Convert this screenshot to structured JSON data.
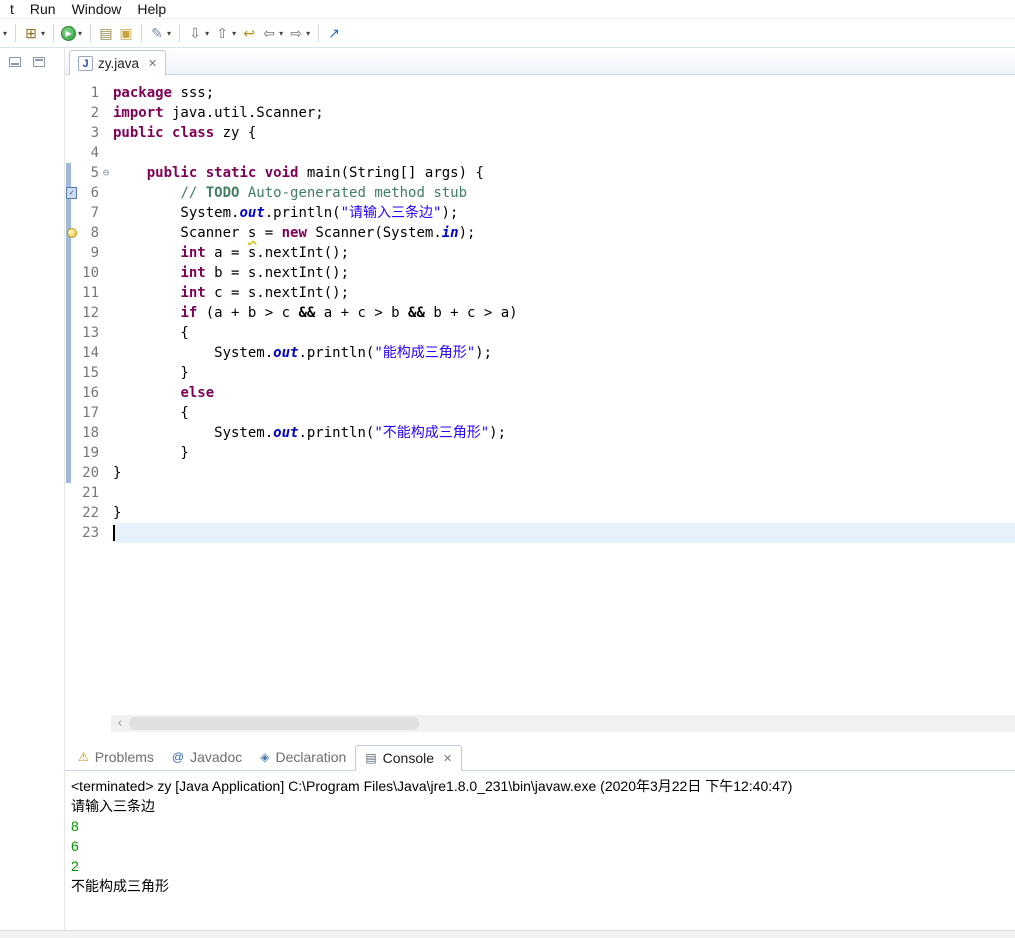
{
  "menu": {
    "items": [
      "t",
      "Run",
      "Window",
      "Help"
    ]
  },
  "toolbar": {
    "items": [
      {
        "type": "caret",
        "name": "toolbar-overflow-caret"
      },
      {
        "type": "sep"
      },
      {
        "type": "icon",
        "name": "new-wizard-icon",
        "glyph": "⊞",
        "color": "#8a6d1c"
      },
      {
        "type": "caret",
        "name": "new-wizard-caret"
      },
      {
        "type": "sep"
      },
      {
        "type": "run",
        "name": "run-icon",
        "glyph": "▶"
      },
      {
        "type": "caret",
        "name": "run-caret"
      },
      {
        "type": "sep"
      },
      {
        "type": "icon",
        "name": "print-icon",
        "glyph": "▤",
        "color": "#9a8a4a"
      },
      {
        "type": "icon",
        "name": "open-folder-icon",
        "glyph": "▣",
        "color": "#c8a43c"
      },
      {
        "type": "sep"
      },
      {
        "type": "icon",
        "name": "format-annotation-icon",
        "glyph": "✎",
        "color": "#7a8aa0"
      },
      {
        "type": "caret",
        "name": "format-annotation-caret"
      },
      {
        "type": "sep"
      },
      {
        "type": "icon",
        "name": "next-annotation-icon",
        "glyph": "⇩",
        "color": "#707070"
      },
      {
        "type": "caret",
        "name": "next-annotation-caret"
      },
      {
        "type": "icon",
        "name": "previous-annotation-icon",
        "glyph": "⇧",
        "color": "#707070"
      },
      {
        "type": "caret",
        "name": "previous-annotation-caret"
      },
      {
        "type": "icon",
        "name": "last-edit-location-icon",
        "glyph": "↩",
        "color": "#b89018"
      },
      {
        "type": "icon",
        "name": "back-icon",
        "glyph": "⇦",
        "color": "#707070"
      },
      {
        "type": "caret",
        "name": "back-caret"
      },
      {
        "type": "icon",
        "name": "forward-icon",
        "glyph": "⇨",
        "color": "#707070"
      },
      {
        "type": "caret",
        "name": "forward-caret"
      },
      {
        "type": "sep"
      },
      {
        "type": "icon",
        "name": "open-task-icon",
        "glyph": "↗",
        "color": "#2a6db5"
      }
    ]
  },
  "editor": {
    "tab": {
      "label": "zy.java",
      "icon_letter": "J",
      "close_glyph": "✕"
    },
    "fold_glyph": "⊖",
    "hscroll_left_glyph": "‹",
    "cursor_line": 23,
    "markers": {
      "6": "task",
      "8": "warning"
    },
    "lines": [
      {
        "tokens": [
          [
            "kw",
            "package"
          ],
          [
            "pl",
            " sss;"
          ]
        ]
      },
      {
        "tokens": [
          [
            "kw",
            "import"
          ],
          [
            "pl",
            " java.util.Scanner;"
          ]
        ]
      },
      {
        "tokens": [
          [
            "kw",
            "public"
          ],
          [
            "pl",
            " "
          ],
          [
            "kw",
            "class"
          ],
          [
            "pl",
            " zy {"
          ]
        ]
      },
      {
        "tokens": []
      },
      {
        "fold": true,
        "tokens": [
          [
            "pl",
            "    "
          ],
          [
            "kw",
            "public"
          ],
          [
            "pl",
            " "
          ],
          [
            "kw",
            "static"
          ],
          [
            "pl",
            " "
          ],
          [
            "kw",
            "void"
          ],
          [
            "pl",
            " main(String[] args) {"
          ]
        ]
      },
      {
        "tokens": [
          [
            "pl",
            "        "
          ],
          [
            "cm",
            "// "
          ],
          [
            "td",
            "TODO"
          ],
          [
            "cm",
            " Auto-generated method stub"
          ]
        ]
      },
      {
        "tokens": [
          [
            "pl",
            "        System."
          ],
          [
            "fd",
            "out"
          ],
          [
            "pl",
            ".println("
          ],
          [
            "st",
            "\"请输入三条边\""
          ],
          [
            "pl",
            ");"
          ]
        ]
      },
      {
        "tokens": [
          [
            "pl",
            "        Scanner "
          ],
          [
            "wn",
            "s"
          ],
          [
            "pl",
            " = "
          ],
          [
            "kw",
            "new"
          ],
          [
            "pl",
            " Scanner(System."
          ],
          [
            "fd",
            "in"
          ],
          [
            "pl",
            ");"
          ]
        ]
      },
      {
        "tokens": [
          [
            "pl",
            "        "
          ],
          [
            "kw",
            "int"
          ],
          [
            "pl",
            " a = s.nextInt();"
          ]
        ]
      },
      {
        "tokens": [
          [
            "pl",
            "        "
          ],
          [
            "kw",
            "int"
          ],
          [
            "pl",
            " b = s.nextInt();"
          ]
        ]
      },
      {
        "tokens": [
          [
            "pl",
            "        "
          ],
          [
            "kw",
            "int"
          ],
          [
            "pl",
            " c = s.nextInt();"
          ]
        ]
      },
      {
        "tokens": [
          [
            "pl",
            "        "
          ],
          [
            "kw",
            "if"
          ],
          [
            "pl",
            " (a + b > c "
          ],
          [
            "op",
            "&&"
          ],
          [
            "pl",
            " a + c > b "
          ],
          [
            "op",
            "&&"
          ],
          [
            "pl",
            " b + c > a)"
          ]
        ]
      },
      {
        "tokens": [
          [
            "pl",
            "        {"
          ]
        ]
      },
      {
        "tokens": [
          [
            "pl",
            "            System."
          ],
          [
            "fd",
            "out"
          ],
          [
            "pl",
            ".println("
          ],
          [
            "st",
            "\"能构成三角形\""
          ],
          [
            "pl",
            ");"
          ]
        ]
      },
      {
        "tokens": [
          [
            "pl",
            "        }"
          ]
        ]
      },
      {
        "tokens": [
          [
            "pl",
            "        "
          ],
          [
            "kw",
            "else"
          ]
        ]
      },
      {
        "tokens": [
          [
            "pl",
            "        {"
          ]
        ]
      },
      {
        "tokens": [
          [
            "pl",
            "            System."
          ],
          [
            "fd",
            "out"
          ],
          [
            "pl",
            ".println("
          ],
          [
            "st",
            "\"不能构成三角形\""
          ],
          [
            "pl",
            ");"
          ]
        ]
      },
      {
        "tokens": [
          [
            "pl",
            "        }"
          ]
        ]
      },
      {
        "tokens": [
          [
            "pl",
            "}"
          ]
        ]
      },
      {
        "tokens": []
      },
      {
        "tokens": [
          [
            "pl",
            "}"
          ]
        ]
      },
      {
        "tokens": []
      }
    ]
  },
  "bottom": {
    "tabs": [
      {
        "label": "Problems",
        "name": "tab-problems",
        "icon_glyph": "⚠",
        "icon_color": "#c49000",
        "active": false
      },
      {
        "label": "Javadoc",
        "name": "tab-javadoc",
        "icon_glyph": "@",
        "icon_color": "#3465a4",
        "active": false
      },
      {
        "label": "Declaration",
        "name": "tab-declaration",
        "icon_glyph": "◈",
        "icon_color": "#4a7ab0",
        "active": false
      },
      {
        "label": "Console",
        "name": "tab-console",
        "icon_glyph": "▤",
        "icon_color": "#5a6a7a",
        "active": true,
        "close_glyph": "✕"
      }
    ],
    "console": {
      "lines": [
        {
          "type": "title",
          "text": "<terminated> zy [Java Application] C:\\Program Files\\Java\\jre1.8.0_231\\bin\\javaw.exe (2020年3月22日 下午12:40:47)"
        },
        {
          "type": "out",
          "text": "请输入三条边"
        },
        {
          "type": "in",
          "text": "8"
        },
        {
          "type": "in",
          "text": "6"
        },
        {
          "type": "in",
          "text": "2"
        },
        {
          "type": "out",
          "text": "不能构成三角形"
        }
      ]
    }
  },
  "colors": {
    "keyword": "#7f0055",
    "string": "#2a00ff",
    "comment": "#3f7f5f",
    "static_field": "#0000c0",
    "line_number": "#787878",
    "current_line": "#e6f1fc",
    "console_input": "#009800",
    "range_indicator": "#9fb9d8"
  }
}
